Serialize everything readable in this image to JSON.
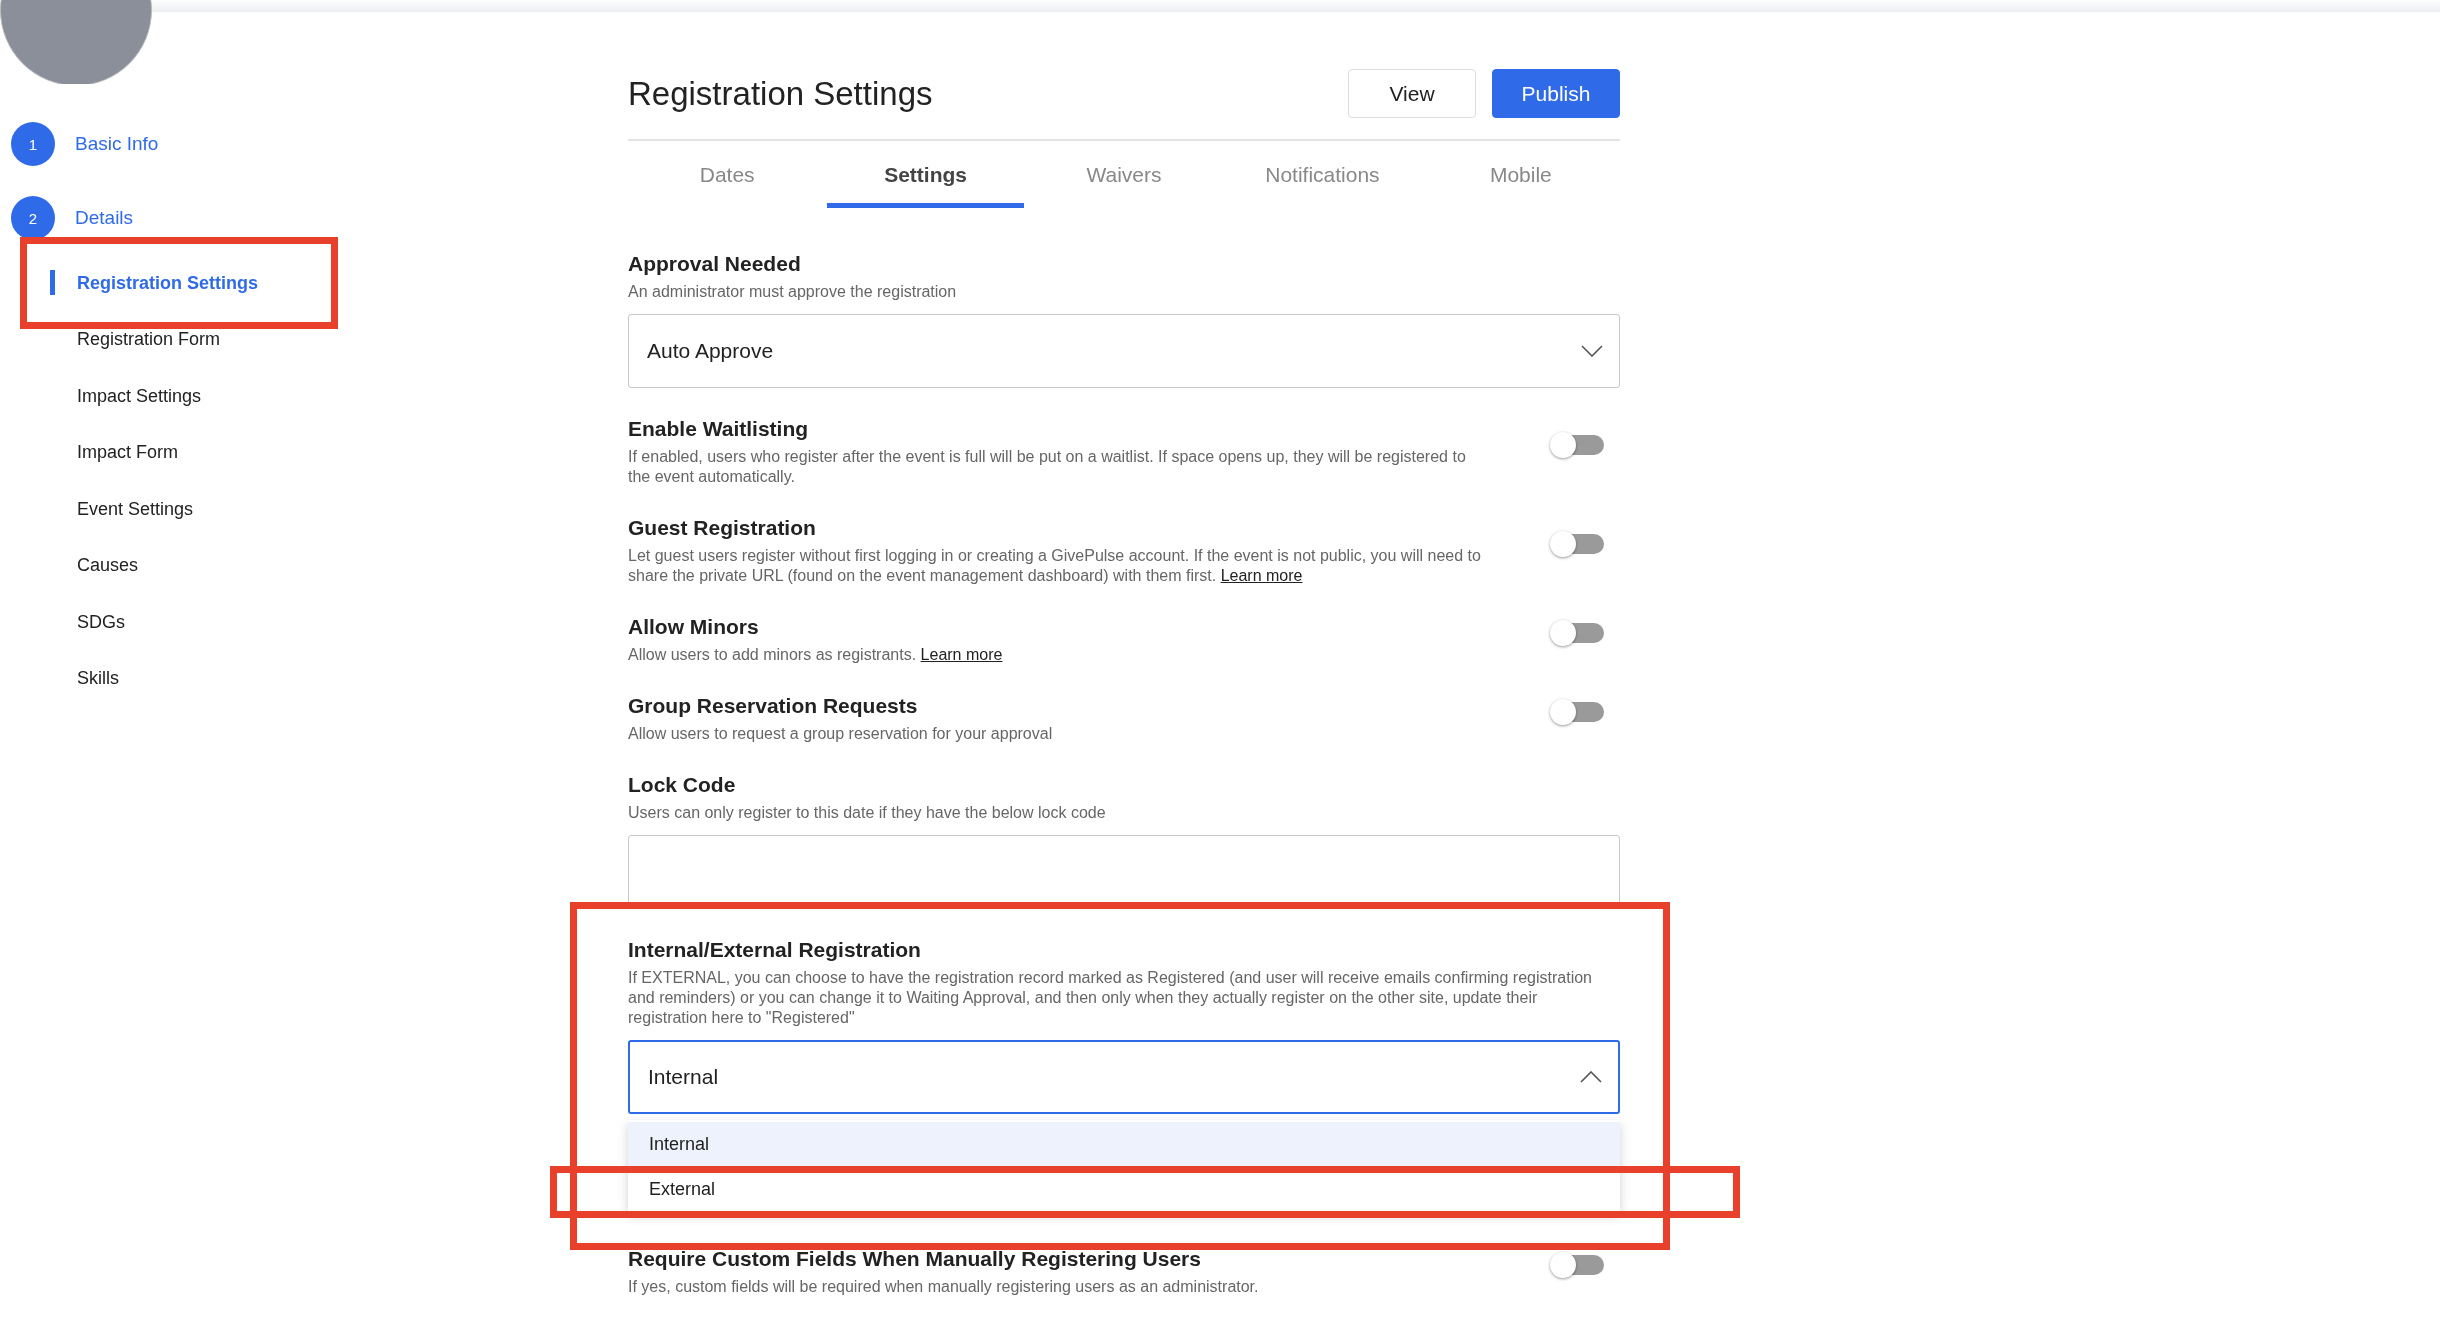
{
  "steps": [
    {
      "number": "1",
      "label": "Basic Info"
    },
    {
      "number": "2",
      "label": "Details",
      "items": [
        {
          "label": "Registration Settings",
          "selected": true,
          "highlighted": true
        },
        {
          "label": "Registration Form",
          "selected": false,
          "highlighted": false
        },
        {
          "label": "Impact Settings",
          "selected": false,
          "highlighted": false
        },
        {
          "label": "Impact Form",
          "selected": false,
          "highlighted": false
        },
        {
          "label": "Event Settings",
          "selected": false,
          "highlighted": false
        },
        {
          "label": "Causes",
          "selected": false,
          "highlighted": false
        },
        {
          "label": "SDGs",
          "selected": false,
          "highlighted": false
        },
        {
          "label": "Skills",
          "selected": false,
          "highlighted": false
        }
      ]
    }
  ],
  "header": {
    "title": "Registration Settings",
    "buttons": [
      {
        "label": "View",
        "kind": "secondary"
      },
      {
        "label": "Publish",
        "kind": "primary"
      }
    ]
  },
  "tabs": [
    {
      "label": "Dates",
      "selected": false
    },
    {
      "label": "Settings",
      "selected": true
    },
    {
      "label": "Waivers",
      "selected": false
    },
    {
      "label": "Notifications",
      "selected": false
    },
    {
      "label": "Mobile",
      "selected": false
    }
  ],
  "settings": [
    {
      "kind": "select",
      "label": "Approval Needed",
      "description": "An administrator must approve the registration",
      "value": "Auto Approve",
      "expanded": false
    },
    {
      "kind": "toggle",
      "label": "Enable Waitlisting",
      "description": "If enabled, users who register after the event is full will be put on a waitlist. If space opens up, they will be registered to the event automatically.",
      "on": false
    },
    {
      "kind": "toggle",
      "label": "Guest Registration",
      "description": "Let guest users register without first logging in or creating a GivePulse account. If the event is not public, you will need to share the private URL (found on the event management dashboard) with them first.",
      "link": "Learn more",
      "on": false
    },
    {
      "kind": "toggle",
      "label": "Allow Minors",
      "description": "Allow users to add minors as registrants.",
      "link": "Learn more",
      "on": false
    },
    {
      "kind": "toggle",
      "label": "Group Reservation Requests",
      "description": "Allow users to request a group reservation for your approval",
      "on": false
    },
    {
      "kind": "input",
      "label": "Lock Code",
      "description": "Users can only register to this date if they have the below lock code"
    },
    {
      "kind": "select",
      "label": "Internal/External Registration",
      "description": "If EXTERNAL, you can choose to have the registration record marked as Registered (and user will receive emails confirming registration and reminders) or you can change it to Waiting Approval, and then only when they actually register on the other site, update their registration here to \"Registered\"",
      "value": "Internal",
      "expanded": true,
      "highlighted": true,
      "options": [
        {
          "label": "Internal",
          "selected": true,
          "highlighted": false
        },
        {
          "label": "External",
          "selected": false,
          "highlighted": true
        }
      ]
    },
    {
      "kind": "toggle",
      "label": "Require Custom Fields When Manually Registering Users",
      "description": "If yes, custom fields will be required when manually registering users as an administrator.",
      "on": false
    }
  ]
}
